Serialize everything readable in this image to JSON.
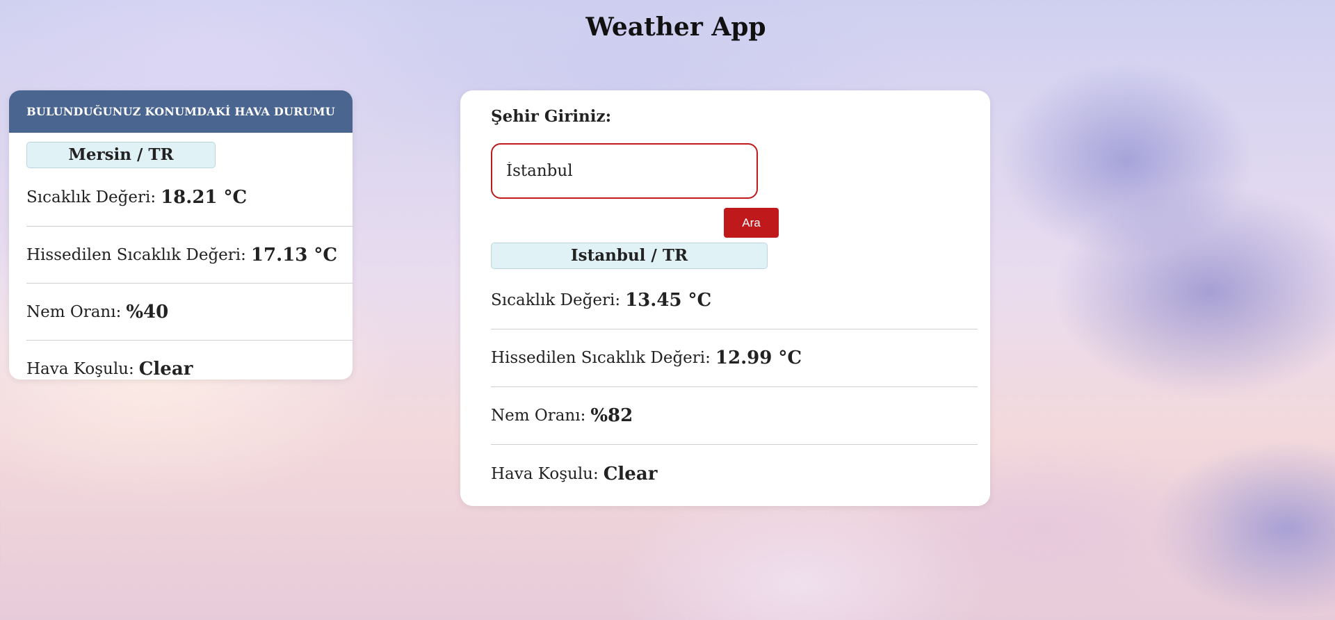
{
  "app": {
    "title": "Weather App"
  },
  "location_card": {
    "header": "BULUNDUĞUNUZ KONUMDAKİ HAVA DURUMU",
    "city": "Mersin / TR",
    "temperature_label": "Sıcaklık Değeri:",
    "temperature_value": "18.21 °C",
    "feels_like_label": "Hissedilen Sıcaklık Değeri:",
    "feels_like_value": "17.13 °C",
    "humidity_label": "Nem Oranı:",
    "humidity_value": "%40",
    "condition_label": "Hava Koşulu:",
    "condition_value": "Clear"
  },
  "search": {
    "label": "Şehir Giriniz:",
    "value": "İstanbul",
    "button_label": "Ara"
  },
  "result_card": {
    "city": "Istanbul / TR",
    "temperature_label": "Sıcaklık Değeri:",
    "temperature_value": "13.45 °C",
    "feels_like_label": "Hissedilen Sıcaklık Değeri:",
    "feels_like_value": "12.99 °C",
    "humidity_label": "Nem Oranı:",
    "humidity_value": "%82",
    "condition_label": "Hava Koşulu:",
    "condition_value": "Clear"
  },
  "colors": {
    "header_bg": "#4a6590",
    "accent_red": "#c0191c",
    "city_pill_bg": "#e1f2f7"
  }
}
